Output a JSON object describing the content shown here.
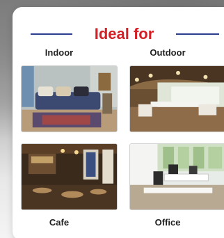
{
  "section": {
    "title": "Ideal for",
    "title_color": "#d41f26",
    "rule_color": "#2a3d8f"
  },
  "categories": [
    {
      "label": "Indoor"
    },
    {
      "label": "Outdoor"
    },
    {
      "label": "Cafe"
    },
    {
      "label": "Office"
    }
  ]
}
